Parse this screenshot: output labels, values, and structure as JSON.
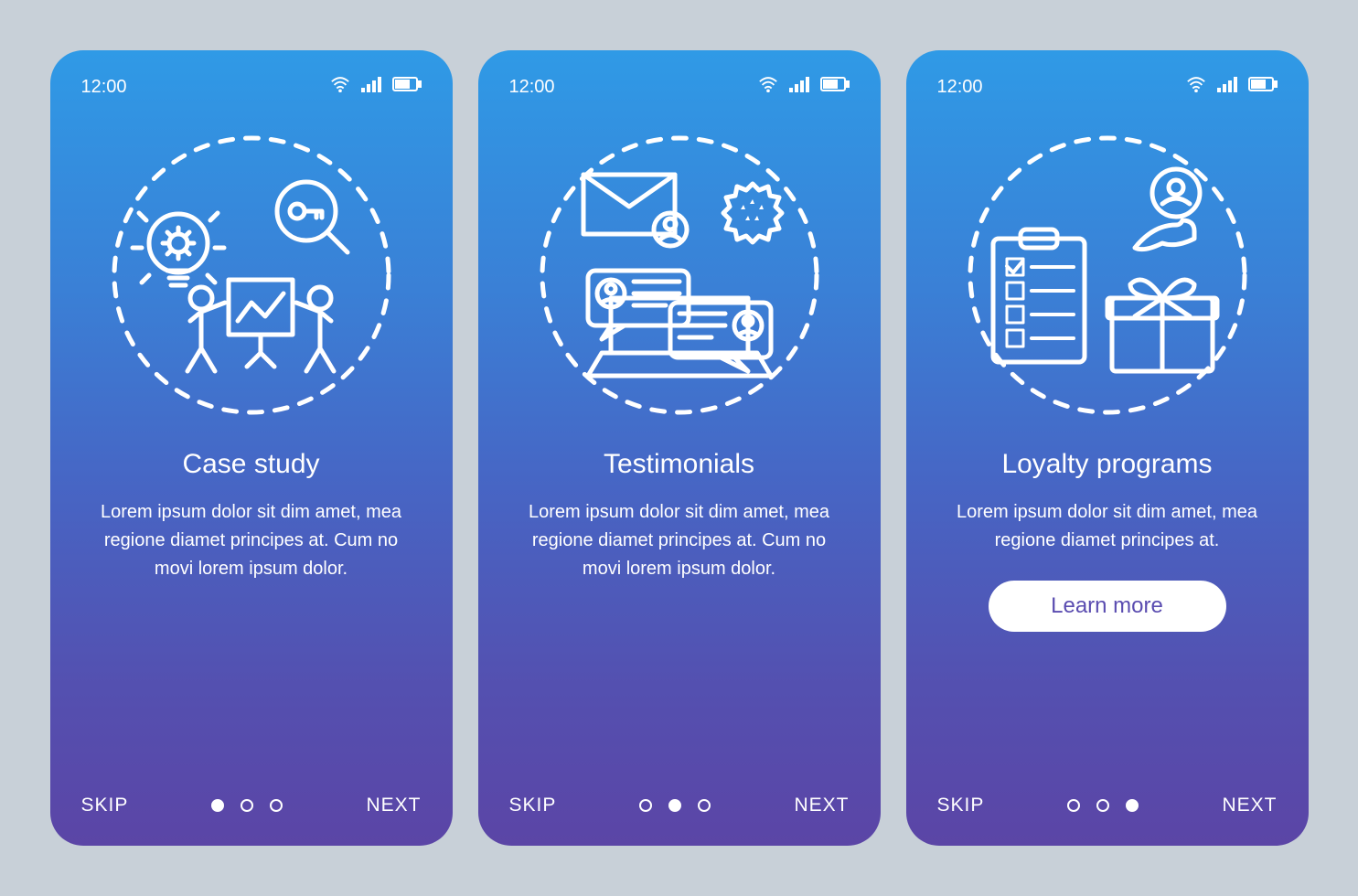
{
  "status": {
    "time": "12:00"
  },
  "nav": {
    "skip": "SKIP",
    "next": "NEXT"
  },
  "cta": {
    "learn_more": "Learn more"
  },
  "screens": [
    {
      "title": "Case study",
      "body": "Lorem ipsum dolor sit dim amet, mea regione diamet principes at. Cum no movi lorem ipsum dolor.",
      "active_dot": 0
    },
    {
      "title": "Testimonials",
      "body": "Lorem ipsum dolor sit dim amet, mea regione diamet principes at. Cum no movi lorem ipsum dolor.",
      "active_dot": 1
    },
    {
      "title": "Loyalty programs",
      "body": "Lorem ipsum dolor sit dim amet, mea regione diamet principes at.",
      "active_dot": 2
    }
  ]
}
